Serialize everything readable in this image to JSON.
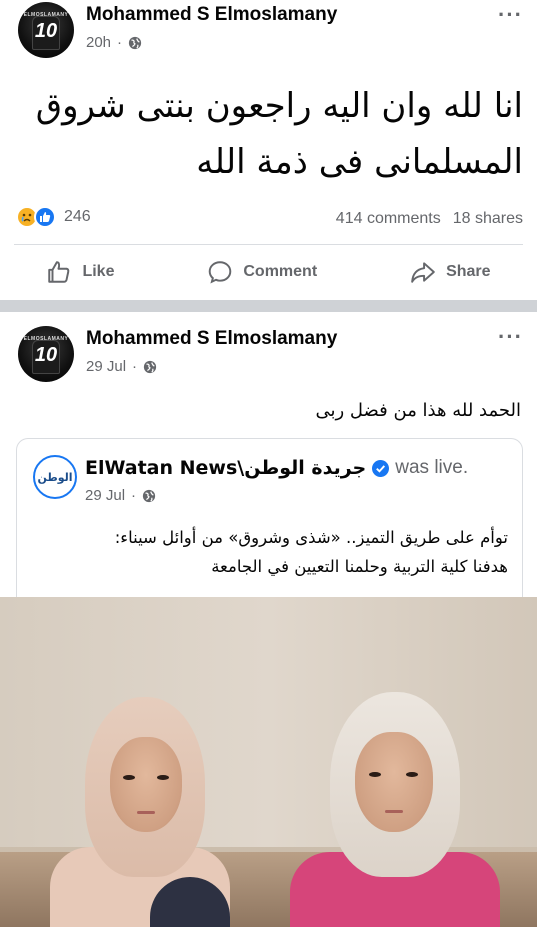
{
  "post1": {
    "author": "Mohammed S Elmoslamany",
    "time": "20h",
    "more": "···",
    "text_line1": "انا لله وان اليه راجعون بنتى شروق",
    "text_line2": "المسلمانى فى ذمة الله",
    "reaction_count": "246",
    "comments": "414 comments",
    "shares": "18 shares",
    "avatar_number": "10",
    "avatar_tag": "ELMOSLAMANY"
  },
  "actions": {
    "like": "Like",
    "comment": "Comment",
    "share": "Share"
  },
  "post2": {
    "author": "Mohammed S Elmoslamany",
    "time": "29 Jul",
    "more": "···",
    "text": "الحمد لله هذا من فضل ربى",
    "avatar_number": "10",
    "avatar_tag": "ELMOSLAMANY"
  },
  "shared_post": {
    "page_name": "ElWatan News\\جريدة الوطن",
    "status": "was live.",
    "time": "29 Jul",
    "logo_text": "الوطن",
    "text_line1": "توأم على طريق التميز.. «شذى وشروق» من أوائل سيناء:",
    "text_line2": "هدفنا كلية التربية وحلمنا التعيين في الجامعة"
  },
  "colors": {
    "secondary_text": "#65676b",
    "brand_blue": "#1877f2",
    "divider": "#cfd2d6"
  }
}
